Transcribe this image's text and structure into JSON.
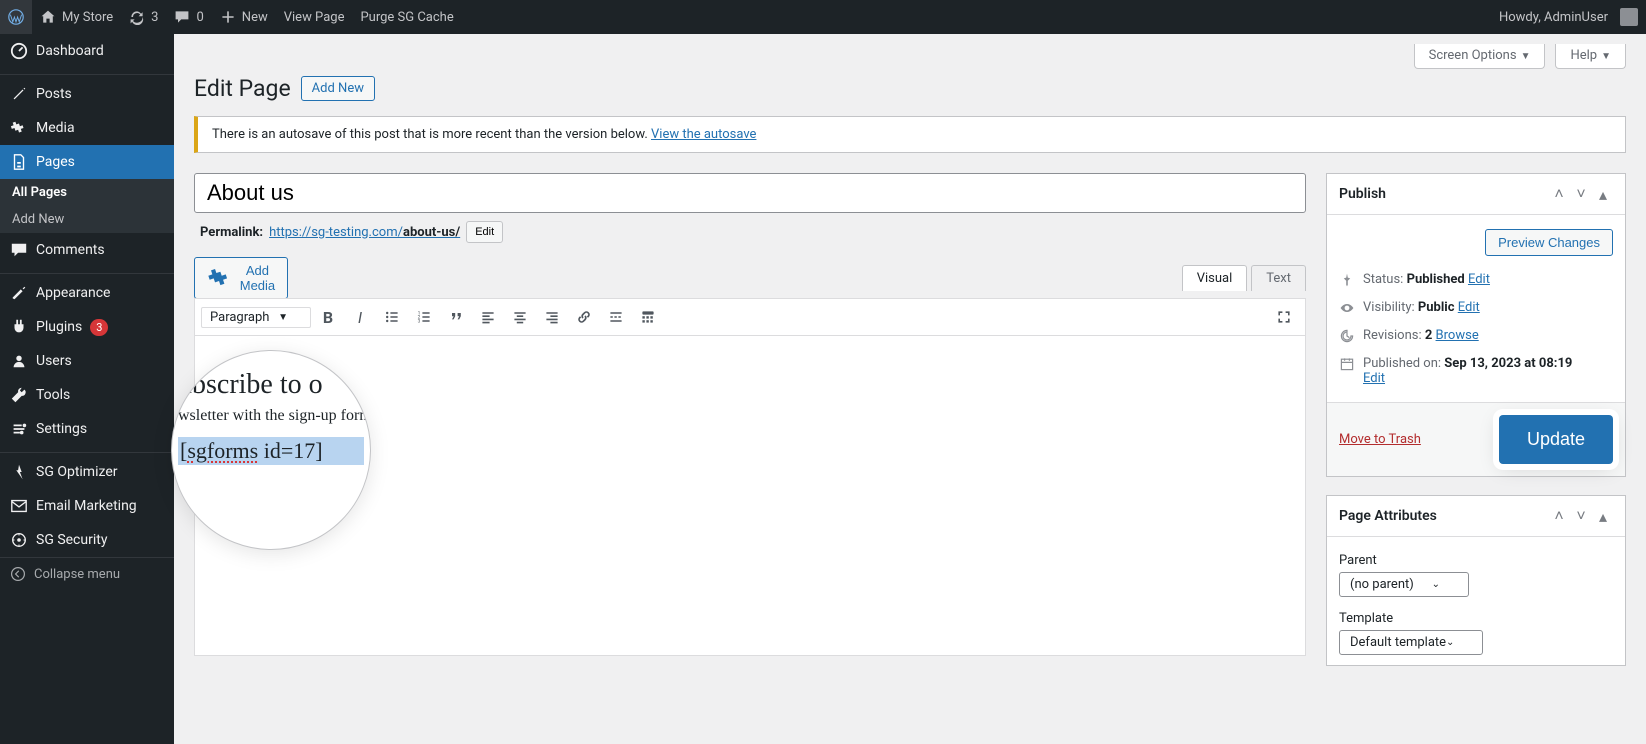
{
  "adminbar": {
    "site_name": "My Store",
    "updates": "3",
    "comments": "0",
    "new": "New",
    "view_page": "View Page",
    "purge": "Purge SG Cache",
    "howdy": "Howdy, AdminUser"
  },
  "sidebar": {
    "dashboard": "Dashboard",
    "posts": "Posts",
    "media": "Media",
    "pages": "Pages",
    "pages_sub_all": "All Pages",
    "pages_sub_add": "Add New",
    "comments": "Comments",
    "appearance": "Appearance",
    "plugins": "Plugins",
    "plugins_badge": "3",
    "users": "Users",
    "tools": "Tools",
    "settings": "Settings",
    "sg_optimizer": "SG Optimizer",
    "email_marketing": "Email Marketing",
    "sg_security": "SG Security",
    "collapse": "Collapse menu"
  },
  "screen_tabs": {
    "options": "Screen Options",
    "help": "Help"
  },
  "heading": {
    "title": "Edit Page",
    "add_new": "Add New"
  },
  "notice": {
    "text": "There is an autosave of this post that is more recent than the version below.",
    "link": "View the autosave"
  },
  "title_field": {
    "value": "About us"
  },
  "permalink": {
    "label": "Permalink:",
    "base": "https://sg-testing.com/",
    "slug": "about-us/",
    "edit": "Edit"
  },
  "editor": {
    "add_media": "Add Media",
    "tab_visual": "Visual",
    "tab_text": "Text",
    "format_select": "Paragraph",
    "body_h2": "ubscribe to o",
    "body_p": "wsletter with the sign-up form below.",
    "shortcode_open": "[",
    "shortcode_word": "sgforms",
    "shortcode_rest": " id=17]"
  },
  "publish": {
    "header": "Publish",
    "preview": "Preview Changes",
    "status_label": "Status:",
    "status_value": "Published",
    "status_edit": "Edit",
    "visibility_label": "Visibility:",
    "visibility_value": "Public",
    "visibility_edit": "Edit",
    "revisions_label": "Revisions:",
    "revisions_value": "2",
    "revisions_browse": "Browse",
    "published_label": "Published on:",
    "published_value": "Sep 13, 2023 at 08:19",
    "published_edit": "Edit",
    "trash": "Move to Trash",
    "update": "Update"
  },
  "attributes": {
    "header": "Page Attributes",
    "parent_label": "Parent",
    "parent_value": "(no parent)",
    "template_label": "Template",
    "template_value": "Default template"
  }
}
